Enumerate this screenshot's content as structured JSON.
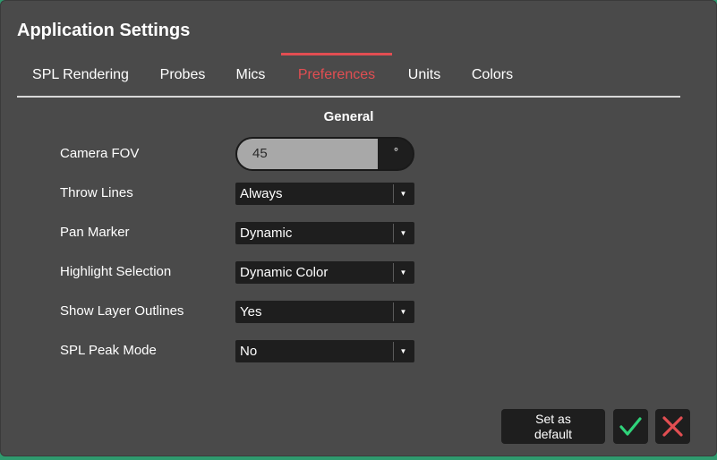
{
  "dialog": {
    "title": "Application Settings"
  },
  "tabs": [
    {
      "label": "SPL Rendering"
    },
    {
      "label": "Probes"
    },
    {
      "label": "Mics"
    },
    {
      "label": "Preferences",
      "active": true
    },
    {
      "label": "Units"
    },
    {
      "label": "Colors"
    }
  ],
  "section": {
    "title": "General"
  },
  "settings": {
    "camera_fov": {
      "label": "Camera FOV",
      "value": "45",
      "unit": "°"
    },
    "throw_lines": {
      "label": "Throw Lines",
      "value": "Always"
    },
    "pan_marker": {
      "label": "Pan Marker",
      "value": "Dynamic"
    },
    "highlight_selection": {
      "label": "Highlight Selection",
      "value": "Dynamic Color"
    },
    "show_layer_outlines": {
      "label": "Show Layer Outlines",
      "value": "Yes"
    },
    "spl_peak_mode": {
      "label": "SPL Peak Mode",
      "value": "No"
    }
  },
  "footer": {
    "set_default_line1": "Set as",
    "set_default_line2": "default",
    "confirm_icon": "check-icon",
    "cancel_icon": "close-icon"
  },
  "colors": {
    "accent": "#e24e52",
    "confirm": "#2fd37a",
    "cancel": "#e24e52",
    "panel": "#4a4a4a",
    "control": "#1e1e1e"
  }
}
